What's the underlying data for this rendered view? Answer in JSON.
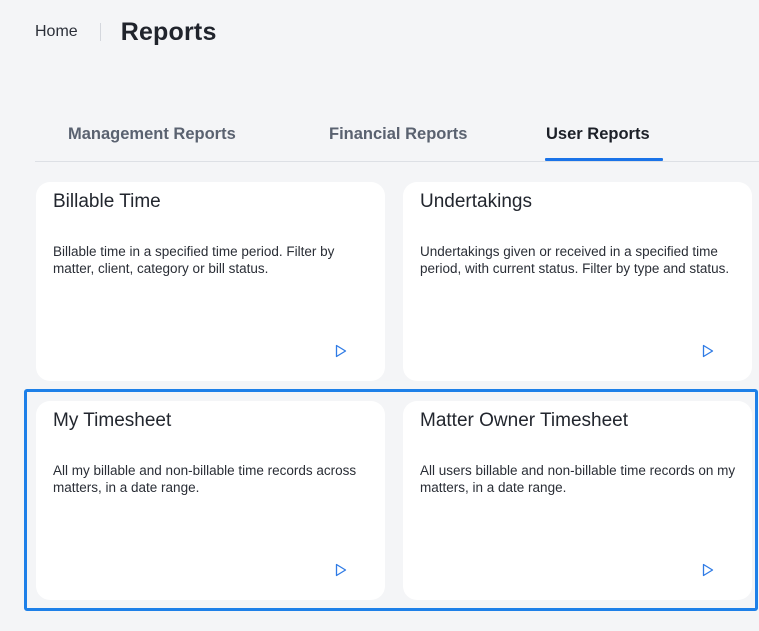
{
  "breadcrumb": {
    "home": "Home",
    "title": "Reports"
  },
  "tabs": [
    {
      "label": "Management Reports",
      "active": false
    },
    {
      "label": "Financial Reports",
      "active": false
    },
    {
      "label": "User Reports",
      "active": true
    }
  ],
  "cards": [
    {
      "title": "Billable Time",
      "description": "Billable time in a specified time period. Filter by matter, client, category or bill status.",
      "action_icon": "play-icon"
    },
    {
      "title": "Undertakings",
      "description": "Undertakings given or received in a specified time period, with current status. Filter by type and status.",
      "action_icon": "play-icon"
    },
    {
      "title": "My Timesheet",
      "description": "All my billable and non-billable time records across matters, in a date range.",
      "action_icon": "play-icon"
    },
    {
      "title": "Matter Owner Timesheet",
      "description": "All users billable and non-billable time records on my matters, in a date range.",
      "action_icon": "play-icon"
    }
  ],
  "colors": {
    "background": "#f4f5f7",
    "accent": "#1a73e8",
    "highlight_border": "#1e80e8",
    "card": "#ffffff"
  }
}
